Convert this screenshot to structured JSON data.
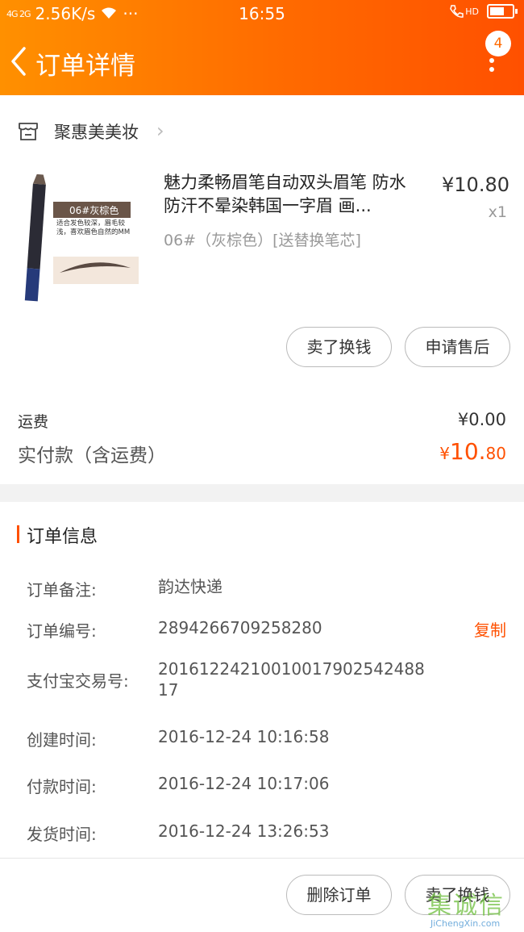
{
  "status_bar": {
    "signal": "4G 2G",
    "speed": "2.56K/s",
    "dots": "···",
    "time": "16:55",
    "hd": "HD"
  },
  "header": {
    "title": "订单详情",
    "badge": "4"
  },
  "store": {
    "name": "聚惠美美妆"
  },
  "product": {
    "title": "魅力柔畅眉笔自动双头眉笔 防水防汗不晕染韩国一字眉 画...",
    "variant": "06#（灰棕色）[送替换笔芯]",
    "price": "¥10.80",
    "qty": "x1",
    "thumb_label": "06#灰棕色",
    "thumb_desc": "适合发色较深，眉毛较浅，喜欢眉色自然的MM"
  },
  "actions_top": {
    "sell": "卖了换钱",
    "after_sale": "申请售后"
  },
  "fees": {
    "shipping_label": "运费",
    "shipping_value": "¥0.00",
    "paid_label": "实付款（含运费）",
    "paid_currency": "¥",
    "paid_int": "10.",
    "paid_dec": "80"
  },
  "order_info": {
    "title": "订单信息",
    "rows": [
      {
        "label": "订单备注:",
        "value": "韵达快递"
      },
      {
        "label": "订单编号:",
        "value": "2894266709258280"
      },
      {
        "label": "支付宝交易号:",
        "value": "20161224210010017902542488 17"
      },
      {
        "label": "创建时间:",
        "value": "2016-12-24 10:16:58"
      },
      {
        "label": "付款时间:",
        "value": "2016-12-24 10:17:06"
      },
      {
        "label": "发货时间:",
        "value": "2016-12-24 13:26:53"
      }
    ],
    "copy": "复制"
  },
  "actions_bottom": {
    "delete": "删除订单",
    "sell": "卖了换钱"
  },
  "watermark": {
    "logo": "集诚信",
    "url": "JiChengXin.com"
  },
  "colors": {
    "accent": "#ff5000",
    "header_start": "#ff9000",
    "header_end": "#ff5000"
  }
}
